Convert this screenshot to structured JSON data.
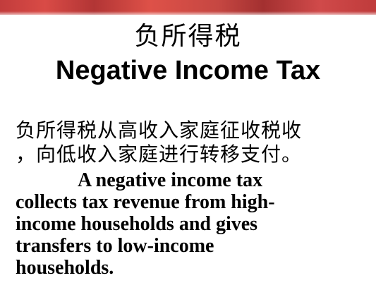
{
  "slide": {
    "title_cn": "负所得税",
    "title_en": "Negative Income Tax",
    "body_cn_line1": "负所得税从高收入家庭征收税收",
    "body_cn_line2": "，向低收入家庭进行转移支付。",
    "body_en_lines": [
      "A  negative income tax",
      "collects tax revenue from high-",
      "income households and gives",
      "transfers to low-income",
      "households."
    ]
  },
  "colors": {
    "top_band": "#c23c3c",
    "text": "#000000",
    "background": "#ffffff"
  }
}
